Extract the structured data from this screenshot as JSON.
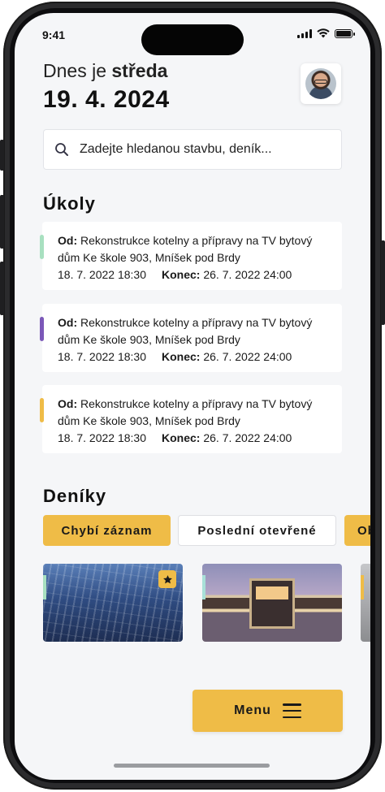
{
  "status_bar": {
    "time": "9:41"
  },
  "header": {
    "greeting_prefix": "Dnes je",
    "weekday": "středa",
    "date": "19. 4. 2024"
  },
  "search": {
    "placeholder": "Zadejte hledanou stavbu, deník..."
  },
  "tasks_section": {
    "title": "Úkoly",
    "items": [
      {
        "from_label": "Od:",
        "description_line1": "Rekonstrukce kotelny a přípravy na TV bytový",
        "description_line2": "dům Ke škole 903, Mníšek pod Brdy",
        "start": "18. 7. 2022 18:30",
        "end_label": "Konec:",
        "end": "26. 7. 2022 24:00",
        "accent_color": "#a8e0c0"
      },
      {
        "from_label": "Od:",
        "description_line1": "Rekonstrukce kotelny a přípravy na TV bytový",
        "description_line2": "dům Ke škole 903, Mníšek pod Brdy",
        "start": "18. 7. 2022 18:30",
        "end_label": "Konec:",
        "end": "26. 7. 2022 24:00",
        "accent_color": "#7b58b8"
      },
      {
        "from_label": "Od:",
        "description_line1": "Rekonstrukce kotelny a přípravy na TV bytový",
        "description_line2": "dům Ke škole 903, Mníšek pod Brdy",
        "start": "18. 7. 2022 18:30",
        "end_label": "Konec:",
        "end": "26. 7. 2022 24:00",
        "accent_color": "#efbc47"
      }
    ]
  },
  "diaries_section": {
    "title": "Deníky",
    "filters": [
      {
        "label": "Chybí záznam",
        "active": true
      },
      {
        "label": "Poslední otevřené",
        "active": false
      },
      {
        "label": "Ob",
        "active": true
      }
    ],
    "cards": [
      {
        "image": "glass-building",
        "starred": true,
        "accent_color": "#a8e0c0"
      },
      {
        "image": "modern-house",
        "starred": false,
        "accent_color": "#a8e0d8"
      },
      {
        "image": "building-partial",
        "starred": false,
        "accent_color": "#efbc47"
      }
    ]
  },
  "menu_button": {
    "label": "Menu",
    "icon": "hamburger-icon"
  },
  "colors": {
    "accent": "#efbc47",
    "background": "#f5f6f8"
  },
  "icons": [
    "search-icon",
    "star-icon",
    "hamburger-icon",
    "signal-icon",
    "wifi-icon",
    "battery-icon"
  ]
}
